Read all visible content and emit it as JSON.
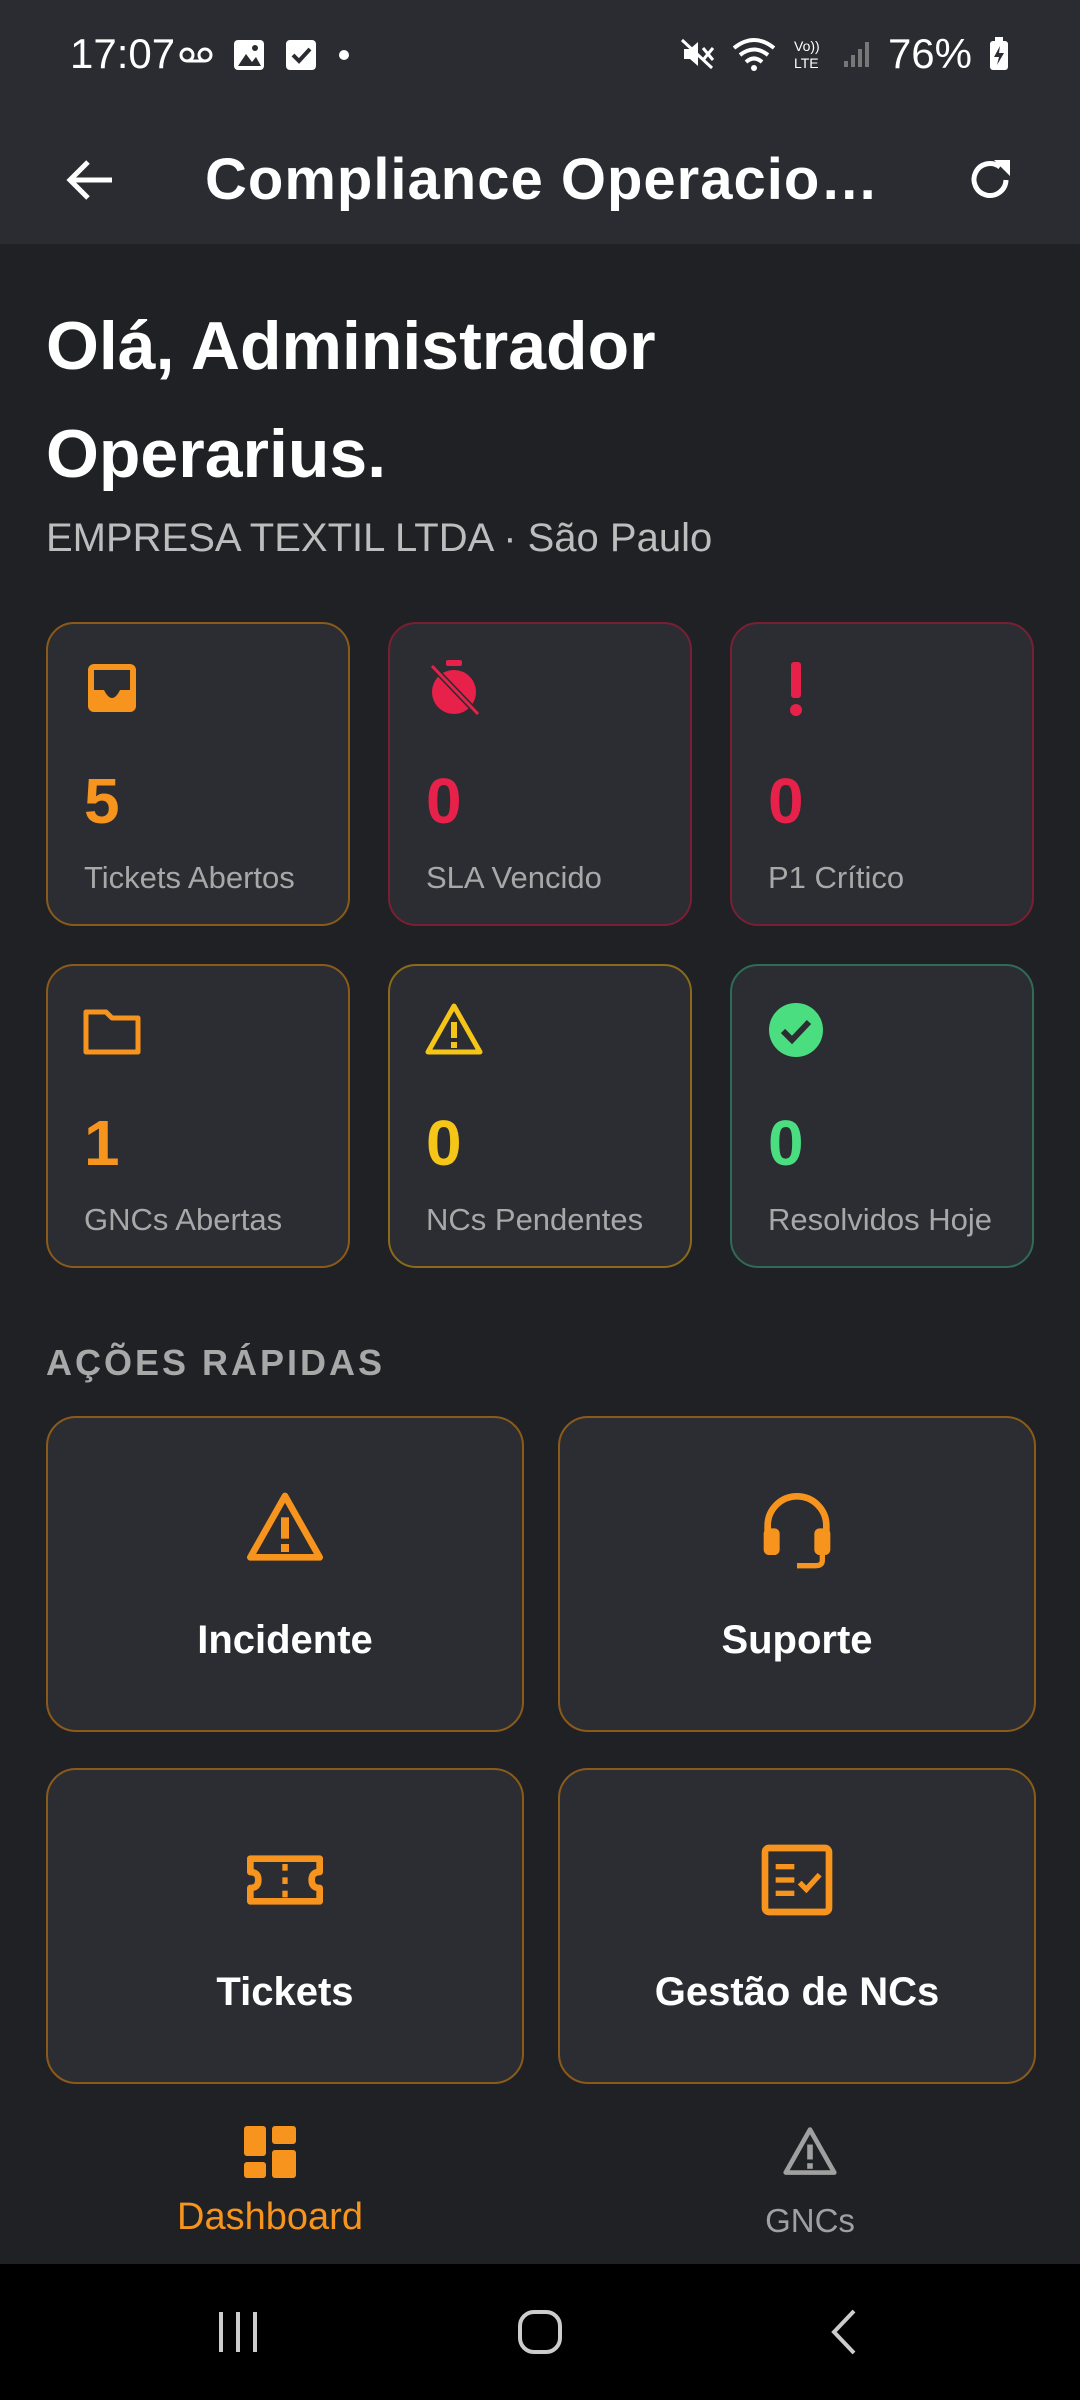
{
  "status_bar": {
    "time": "17:07",
    "battery": "76%",
    "left_icons": [
      "voicemail-icon",
      "gallery-icon",
      "task-check-icon",
      "dot-icon"
    ],
    "right_icons": [
      "mute-icon",
      "wifi-icon",
      "volte-icon",
      "signal-icon",
      "battery-charging-icon"
    ]
  },
  "app_bar": {
    "title": "Compliance Operacio…",
    "back_icon": "arrow-back-icon",
    "refresh_icon": "refresh-icon"
  },
  "greeting": {
    "line1": "Olá, Administrador",
    "line2": "Operarius.",
    "company": "EMPRESA TEXTIL LTDA · São Paulo"
  },
  "stats": [
    {
      "icon": "inbox-icon",
      "value": "5",
      "label": "Tickets Abertos",
      "color": "#f7941d",
      "border": "#8a5a1a"
    },
    {
      "icon": "timer-off-icon",
      "value": "0",
      "label": "SLA Vencido",
      "color": "#e8214a",
      "border": "#7a1f33"
    },
    {
      "icon": "exclamation-icon",
      "value": "0",
      "label": "P1 Crítico",
      "color": "#e8214a",
      "border": "#7a1f33"
    },
    {
      "icon": "folder-icon",
      "value": "1",
      "label": "GNCs Abertas",
      "color": "#f7941d",
      "border": "#8a5a1a"
    },
    {
      "icon": "warning-icon",
      "value": "0",
      "label": "NCs Pendentes",
      "color": "#f5c518",
      "border": "#8a6a1a"
    },
    {
      "icon": "check-circle-icon",
      "value": "0",
      "label": "Resolvidos Hoje",
      "color": "#4ade80",
      "border": "#2f6b55"
    }
  ],
  "quick_actions": {
    "title": "AÇÕES RÁPIDAS",
    "items": [
      {
        "icon": "warning-icon",
        "label": "Incidente"
      },
      {
        "icon": "headset-icon",
        "label": "Suporte"
      },
      {
        "icon": "ticket-icon",
        "label": "Tickets"
      },
      {
        "icon": "checklist-icon",
        "label": "Gestão de NCs"
      }
    ]
  },
  "bottom_nav": {
    "items": [
      {
        "icon": "dashboard-icon",
        "label": "Dashboard",
        "active": true
      },
      {
        "icon": "warning-icon",
        "label": "GNCs",
        "active": false
      }
    ]
  },
  "colors": {
    "accent": "#f7941d",
    "danger": "#e8214a",
    "warning": "#f5c518",
    "success": "#4ade80",
    "background": "#1f2124",
    "surface": "#2b2d32"
  }
}
